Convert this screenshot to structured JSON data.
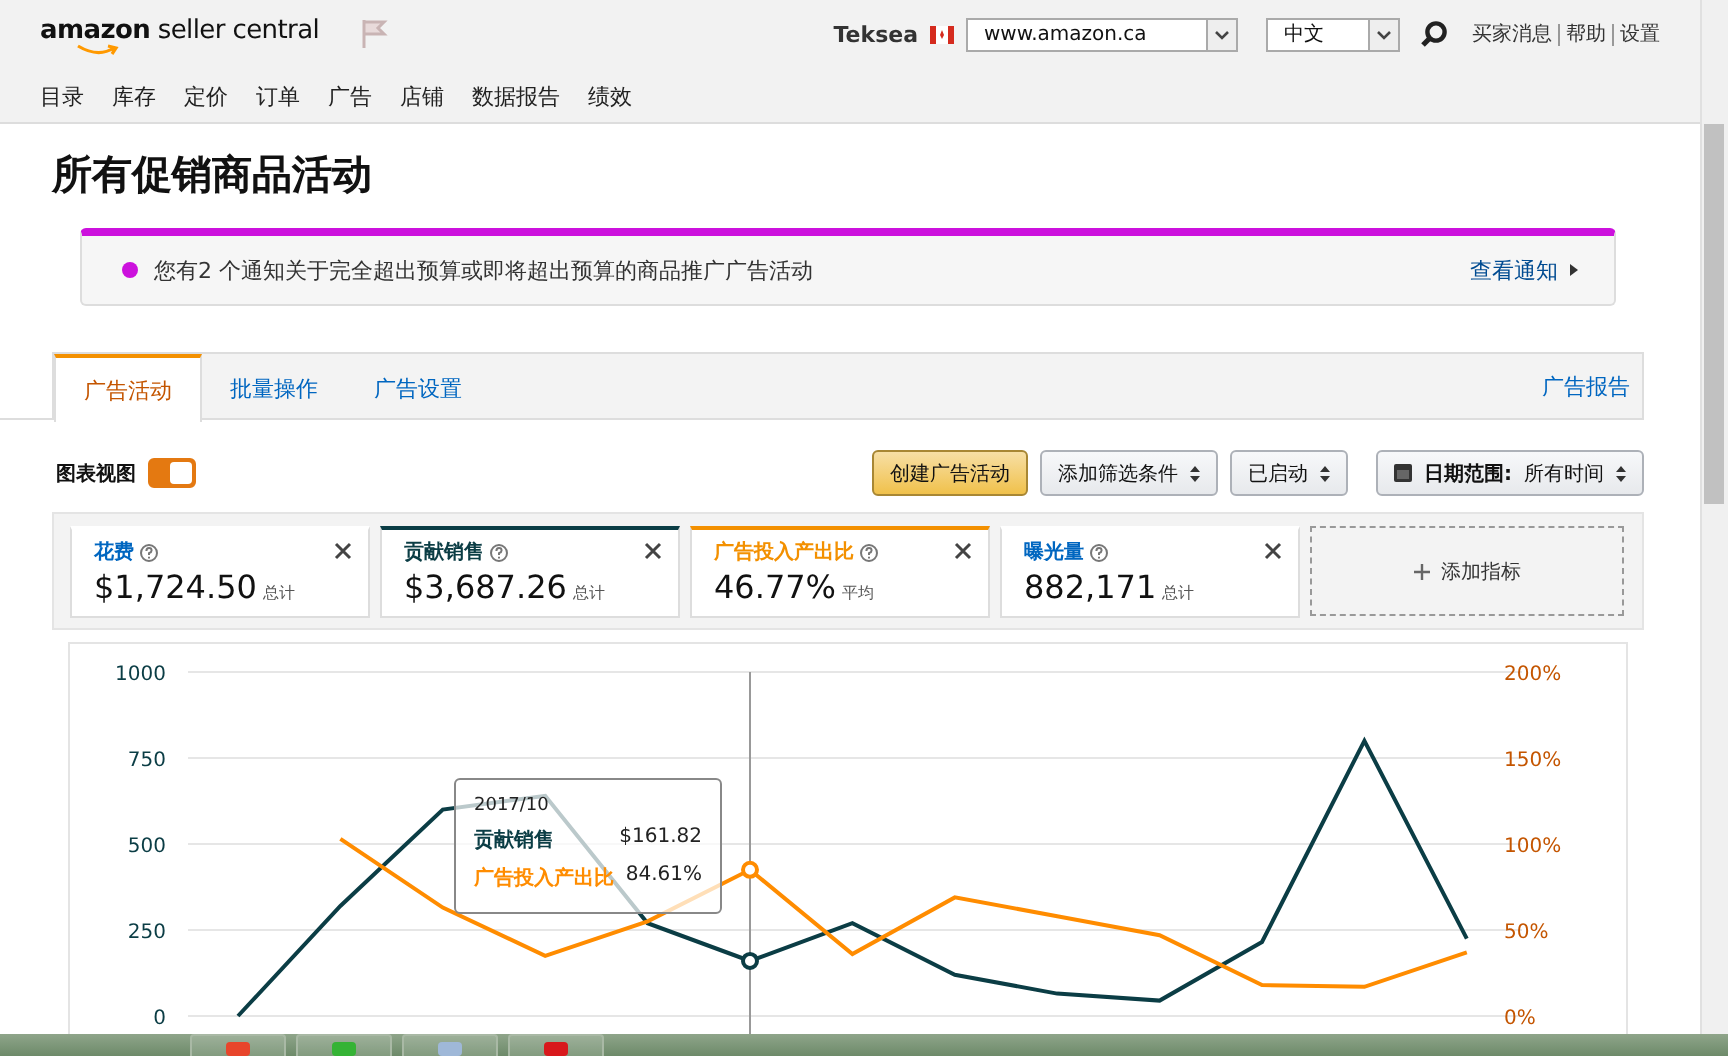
{
  "header": {
    "logo": "**amazon** seller central",
    "seller": "Teksea",
    "marketplace": "www.amazon.ca",
    "language": "中文",
    "links": [
      "买家消息",
      "帮助",
      "设置"
    ],
    "nav": [
      "目录",
      "库存",
      "定价",
      "订单",
      "广告",
      "店铺",
      "数据报告",
      "绩效"
    ]
  },
  "page_title": "所有促销商品活动",
  "notice": {
    "text": "您有2 个通知关于完全超出预算或即将超出预算的商品推广广告活动",
    "link": "查看通知",
    "color": "#cc11dd"
  },
  "tabs": [
    {
      "label": "广告活动",
      "selected": true
    },
    {
      "label": "批量操作",
      "selected": false
    },
    {
      "label": "广告设置",
      "selected": false
    }
  ],
  "report_link": "广告报告",
  "chart_view": {
    "label": "图表视图",
    "on": true
  },
  "buttons": [
    {
      "kind": "primary",
      "label": "创建广告活动"
    },
    {
      "kind": "dropdown",
      "label": "添加筛选条件"
    },
    {
      "kind": "dropdown",
      "label": "已启动"
    },
    {
      "kind": "date",
      "label": "日期范围:",
      "value": "所有时间"
    }
  ],
  "metrics": [
    {
      "name": "花费",
      "value": "$1,724.50",
      "note": "总计",
      "selected": false,
      "color": "#0066c0"
    },
    {
      "name": "贡献销售",
      "value": "$3,687.26",
      "note": "总计",
      "selected": true,
      "color": "#0b3d45"
    },
    {
      "name": "广告投入产出比",
      "value": "46.77%",
      "note": "平均",
      "selected": true,
      "color": "#f39000"
    },
    {
      "name": "曝光量",
      "value": "882,171",
      "note": "总计",
      "selected": false,
      "color": "#0066c0"
    }
  ],
  "add_metric": "添加指标",
  "chart": {
    "chart_data": {
      "type": "line",
      "grid": true,
      "ylim": [
        0,
        1000
      ],
      "yticks": [
        0,
        250,
        500,
        750,
        1000
      ],
      "y2lim": [
        0,
        200
      ],
      "y2ticks": [
        {
          "value": 0,
          "label": "0%"
        },
        {
          "value": 50,
          "label": "50%"
        },
        {
          "value": 100,
          "label": "100%"
        },
        {
          "value": 150,
          "label": "150%"
        },
        {
          "value": 200,
          "label": "200%"
        }
      ],
      "series": [
        {
          "name": "贡献销售",
          "color": "#0b3d45",
          "values": [
            0,
            320,
            600,
            640,
            270,
            160,
            270,
            120,
            65,
            45,
            215,
            800,
            225
          ]
        },
        {
          "name": "广告投入产出比",
          "color": "#ff8c00",
          "axis": "y2",
          "values": [
            null,
            103,
            63,
            35,
            55,
            85,
            36,
            69,
            58,
            47,
            18,
            17,
            37
          ]
        }
      ]
    },
    "hover": {
      "label": "2017/10",
      "values": [
        "$161.82",
        "84.61%"
      ]
    }
  }
}
